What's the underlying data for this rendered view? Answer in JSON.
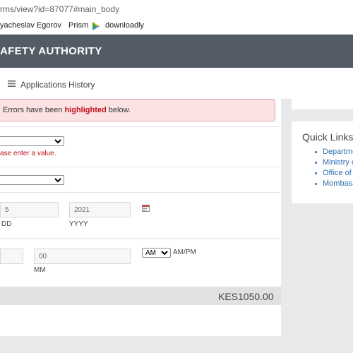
{
  "browser": {
    "url": "rms/view?id=87077#main_body",
    "bookmarks": [
      {
        "label": "yacheslav Egorov"
      },
      {
        "label": "Prism"
      },
      {
        "label": "downloadly"
      }
    ]
  },
  "site": {
    "title": "AFETY AUTHORITY"
  },
  "nav": {
    "label": "Applications History"
  },
  "alert": {
    "prefix": "Errors have been",
    "highlight": "highlighted",
    "suffix": "below."
  },
  "form": {
    "select1": {
      "value": ""
    },
    "error_message": "ase enter a value.",
    "select2": {
      "value": ""
    },
    "date": {
      "day": "5",
      "day_label": "DD",
      "year": "2021",
      "year_label": "YYYY"
    },
    "time": {
      "hour": "",
      "minute": "00",
      "minute_label": "MM",
      "ampm": "AM",
      "ampm_label": "AM/PM"
    },
    "total": "KES1050.00"
  },
  "sidebar": {
    "quick_links_title": "Quick Links",
    "links": [
      "Departme",
      "Ministry o",
      "Office of",
      "Mombasa"
    ]
  },
  "colors": {
    "header_bg": "#525b66",
    "error_red": "#c0111b",
    "link_blue": "#2a6fb0",
    "alert_bg": "#fbe3e4"
  }
}
